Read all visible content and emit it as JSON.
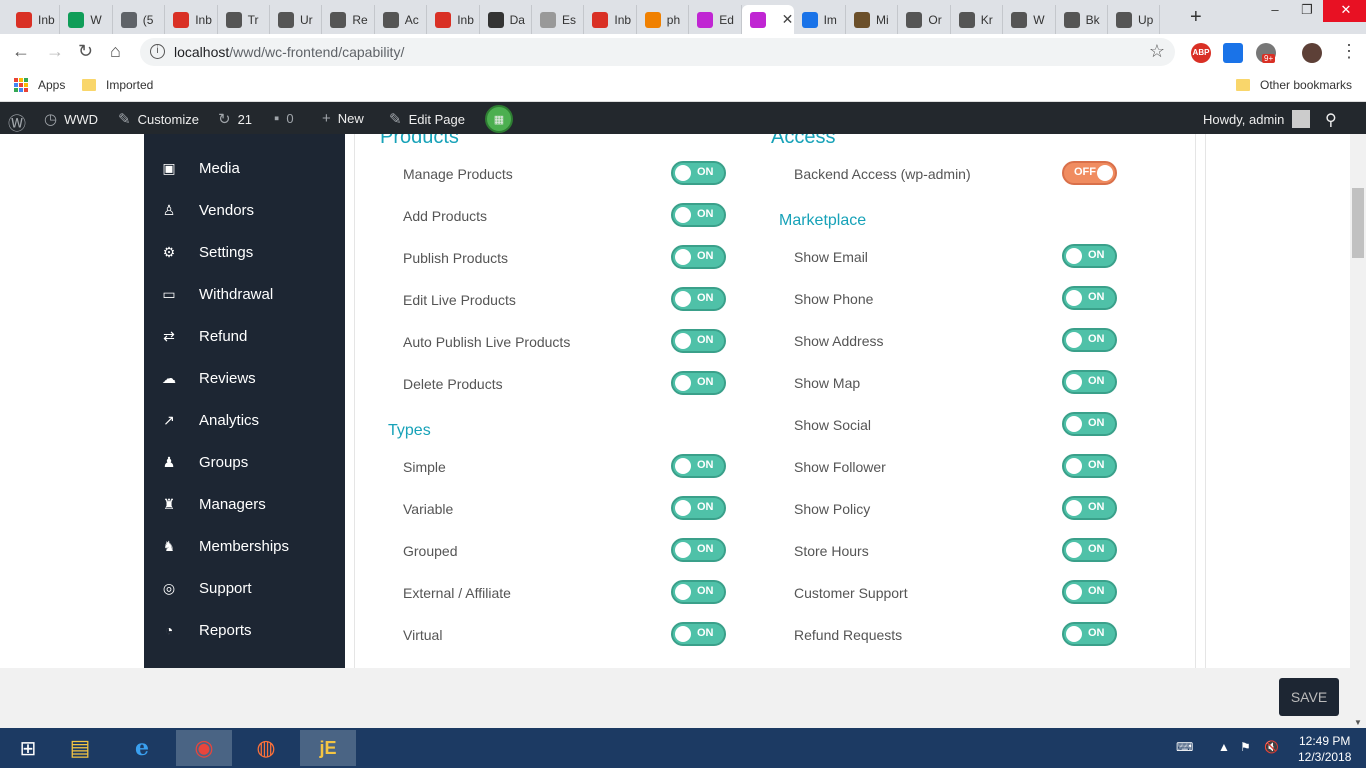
{
  "browser": {
    "tabs": [
      {
        "label": "Inb",
        "icon": "gmail-icon",
        "color": "#d93025"
      },
      {
        "label": "W",
        "icon": "sheets-icon",
        "color": "#0f9d58"
      },
      {
        "label": "(5",
        "icon": "envelope-icon",
        "color": "#5f6368"
      },
      {
        "label": "Inb",
        "icon": "gmail-icon",
        "color": "#d93025"
      },
      {
        "label": "Tr",
        "icon": "app-icon",
        "color": "#555"
      },
      {
        "label": "Ur",
        "icon": "app-icon",
        "color": "#555"
      },
      {
        "label": "Re",
        "icon": "app-icon",
        "color": "#555"
      },
      {
        "label": "Ac",
        "icon": "app-icon",
        "color": "#555"
      },
      {
        "label": "Inb",
        "icon": "gmail-icon",
        "color": "#d93025"
      },
      {
        "label": "Da",
        "icon": "doc-icon",
        "color": "#333"
      },
      {
        "label": "Es",
        "icon": "doc-icon",
        "color": "#999"
      },
      {
        "label": "Inb",
        "icon": "gmail-icon",
        "color": "#d93025"
      },
      {
        "label": "ph",
        "icon": "vlc-icon",
        "color": "#f08000"
      },
      {
        "label": "Ed",
        "icon": "app-icon",
        "color": "#c026d3"
      },
      {
        "label": "",
        "icon": "app-icon",
        "color": "#c026d3"
      },
      {
        "label": "Im",
        "icon": "ibb-icon",
        "color": "#1a73e8"
      },
      {
        "label": "Mi",
        "icon": "app-icon",
        "color": "#6b4f2a"
      },
      {
        "label": "Or",
        "icon": "app-icon",
        "color": "#555"
      },
      {
        "label": "Kr",
        "icon": "app-icon",
        "color": "#555"
      },
      {
        "label": "W",
        "icon": "app-icon",
        "color": "#555"
      },
      {
        "label": "Bk",
        "icon": "app-icon",
        "color": "#555"
      },
      {
        "label": "Up",
        "icon": "app-icon",
        "color": "#555"
      }
    ],
    "active_tab_index": 14,
    "new_tab": "+",
    "url_host": "localhost",
    "url_path": "/wwd/wc-frontend/capability/",
    "bookmarks": {
      "apps": "Apps",
      "imported": "Imported",
      "other": "Other bookmarks"
    },
    "abp_label": "ABP",
    "badge": "9+"
  },
  "adminbar": {
    "site": "WWD",
    "customize": "Customize",
    "updates": "21",
    "comments": "0",
    "new": "New",
    "edit_page": "Edit Page",
    "howdy": "Howdy, admin"
  },
  "sidebar": {
    "items": [
      {
        "label": "Media",
        "icon": "media-icon",
        "glyph": "▣"
      },
      {
        "label": "Vendors",
        "icon": "user-icon",
        "glyph": "♙"
      },
      {
        "label": "Settings",
        "icon": "gears-icon",
        "glyph": "⚙"
      },
      {
        "label": "Withdrawal",
        "icon": "credit-card-icon",
        "glyph": "▭"
      },
      {
        "label": "Refund",
        "icon": "refund-icon",
        "glyph": "⇄"
      },
      {
        "label": "Reviews",
        "icon": "comments-icon",
        "glyph": "☁"
      },
      {
        "label": "Analytics",
        "icon": "line-chart-icon",
        "glyph": "↗"
      },
      {
        "label": "Groups",
        "icon": "users-icon",
        "glyph": "♟"
      },
      {
        "label": "Managers",
        "icon": "manager-icon",
        "glyph": "♜"
      },
      {
        "label": "Memberships",
        "icon": "user-plus-icon",
        "glyph": "♞"
      },
      {
        "label": "Support",
        "icon": "lifebuoy-icon",
        "glyph": "◎"
      },
      {
        "label": "Reports",
        "icon": "pie-chart-icon",
        "glyph": "◔"
      }
    ]
  },
  "left": {
    "products_heading": "Products",
    "products": [
      {
        "label": "Manage Products",
        "state": "ON"
      },
      {
        "label": "Add Products",
        "state": "ON"
      },
      {
        "label": "Publish Products",
        "state": "ON"
      },
      {
        "label": "Edit Live Products",
        "state": "ON"
      },
      {
        "label": "Auto Publish Live Products",
        "state": "ON"
      },
      {
        "label": "Delete Products",
        "state": "ON"
      }
    ],
    "types_heading": "Types",
    "types": [
      {
        "label": "Simple",
        "state": "ON"
      },
      {
        "label": "Variable",
        "state": "ON"
      },
      {
        "label": "Grouped",
        "state": "ON"
      },
      {
        "label": "External / Affiliate",
        "state": "ON"
      },
      {
        "label": "Virtual",
        "state": "ON"
      }
    ]
  },
  "right": {
    "access_heading": "Access",
    "access": [
      {
        "label": "Backend Access (wp-admin)",
        "state": "OFF"
      }
    ],
    "marketplace_heading": "Marketplace",
    "marketplace": [
      {
        "label": "Show Email",
        "state": "ON"
      },
      {
        "label": "Show Phone",
        "state": "ON"
      },
      {
        "label": "Show Address",
        "state": "ON"
      },
      {
        "label": "Show Map",
        "state": "ON"
      },
      {
        "label": "Show Social",
        "state": "ON"
      },
      {
        "label": "Show Follower",
        "state": "ON"
      },
      {
        "label": "Show Policy",
        "state": "ON"
      },
      {
        "label": "Store Hours",
        "state": "ON"
      },
      {
        "label": "Customer Support",
        "state": "ON"
      },
      {
        "label": "Refund Requests",
        "state": "ON"
      }
    ]
  },
  "footer": {
    "save": "SAVE"
  },
  "taskbar": {
    "time": "12:49 PM",
    "date": "12/3/2018"
  },
  "colors": {
    "accent": "#17a2b8",
    "toggle_on": "#4fc1a8",
    "toggle_off": "#f08c60",
    "sidebar_bg": "#1d2633",
    "adminbar_bg": "#23282d"
  }
}
